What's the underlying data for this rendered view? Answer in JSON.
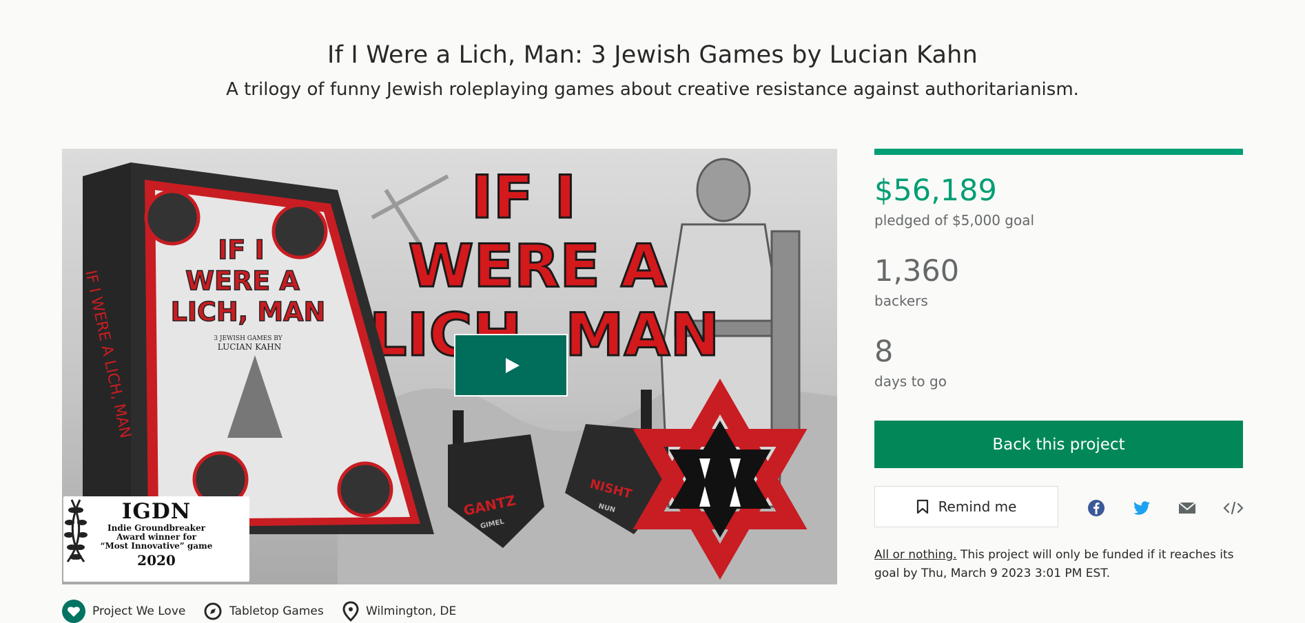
{
  "project": {
    "title": "If I Were a Lich, Man: 3 Jewish Games by Lucian Kahn",
    "subtitle": "A trilogy of funny Jewish roleplaying games about creative resistance against authoritarianism."
  },
  "hero": {
    "art_title_line1": "IF I",
    "art_title_line2": "WERE A",
    "art_title_line3": "LICH, MAN",
    "box_title_line1": "IF I",
    "box_title_line2": "WERE A",
    "box_title_line3": "LICH, MAN",
    "box_byline": "3 JEWISH GAMES BY",
    "box_author": "LUCIAN KAHN",
    "box_spine": "IF I WERE A LICH, MAN",
    "dreidel1_word": "GANTZ",
    "dreidel1_sub": "GIMEL",
    "dreidel2_word": "NISHT",
    "dreidel2_sub": "NUN",
    "badge_big": "IGDN",
    "badge_line1": "Indie Groundbreaker",
    "badge_line2": "Award winner for",
    "badge_line3": "“Most Innovative” game",
    "badge_year": "2020"
  },
  "campaign": {
    "pledged": "$56,189",
    "pledged_label": "pledged of $5,000 goal",
    "backers": "1,360",
    "backers_label": "backers",
    "days": "8",
    "days_label": "days to go",
    "funded_fraction": 1.0,
    "back_label": "Back this project",
    "remind_label": "Remind me",
    "aon_link": "All or nothing.",
    "aon_text": " This project will only be funded if it reaches its goal by Thu, March 9 2023 3:01 PM EST."
  },
  "meta": {
    "pwl": "Project We Love",
    "category": "Tabletop Games",
    "location": "Wilmington, DE"
  },
  "colors": {
    "accent": "#009e74",
    "button": "#028858",
    "play": "#006e5a"
  }
}
